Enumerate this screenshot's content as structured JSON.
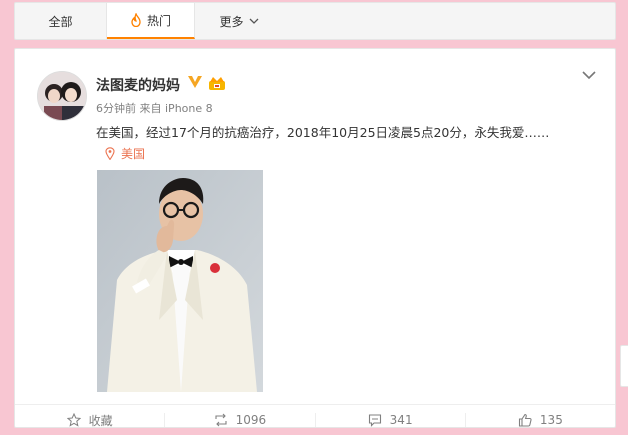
{
  "tabs": {
    "all_label": "全部",
    "hot_label": "热门",
    "more_label": "更多"
  },
  "post": {
    "username": "法图麦的妈妈",
    "time": "6分钟前",
    "source_prefix": "来自",
    "source": "iPhone 8",
    "text": "在美国，经过17个月的抗癌治疗，2018年10月25日凌晨5点20分，永失我爱……",
    "location": "美国"
  },
  "actions": {
    "favorite_label": "收藏",
    "repost_count": "1096",
    "comment_count": "341",
    "like_count": "135"
  },
  "colors": {
    "page_bg": "#f8c6d2",
    "accent_orange": "#ff8200",
    "location_color": "#eb7350",
    "verified_gold": "#f5a623"
  },
  "icons": [
    "flame-icon",
    "chevron-down-icon",
    "verified-badge-icon",
    "crown-icon",
    "location-pin-icon",
    "star-icon",
    "repost-icon",
    "comment-icon",
    "thumbs-up-icon"
  ]
}
